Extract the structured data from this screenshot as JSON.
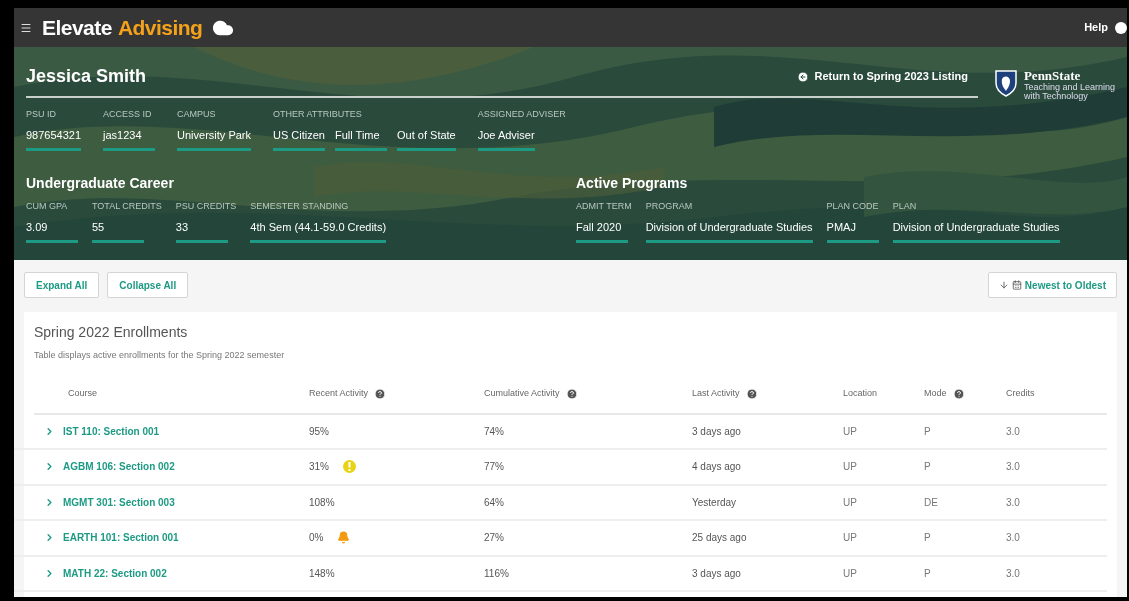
{
  "app": {
    "title_primary": "Elevate",
    "title_accent": "Advising",
    "help": "Help"
  },
  "student": {
    "name": "Jessica Smith",
    "return_link": "Return to Spring 2023 Listing",
    "logo": {
      "name": "PennState",
      "line_1": "Teaching and Learning",
      "line_2": "with Technology"
    },
    "fields": [
      {
        "label": "PSU ID",
        "values": [
          "987654321"
        ]
      },
      {
        "label": "ACCESS ID",
        "values": [
          "jas1234"
        ]
      },
      {
        "label": "CAMPUS",
        "values": [
          "University Park"
        ]
      },
      {
        "label": "OTHER ATTRIBUTES",
        "values": [
          "US Citizen",
          "Full Time",
          "Out of State"
        ]
      },
      {
        "label": "ASSIGNED ADVISER",
        "values": [
          "Joe Adviser"
        ]
      }
    ]
  },
  "career": {
    "title": "Undergraduate Career",
    "fields": [
      {
        "label": "CUM GPA",
        "value": "3.09"
      },
      {
        "label": "TOTAL CREDITS",
        "value": "55"
      },
      {
        "label": "PSU CREDITS",
        "value": "33"
      },
      {
        "label": "SEMESTER STANDING",
        "value": "4th Sem (44.1-59.0 Credits)"
      }
    ]
  },
  "programs": {
    "title": "Active Programs",
    "fields": [
      {
        "label": "ADMIT TERM",
        "value": "Fall 2020"
      },
      {
        "label": "PROGRAM",
        "value": "Division of Undergraduate Studies"
      },
      {
        "label": "PLAN CODE",
        "value": "PMAJ"
      },
      {
        "label": "PLAN",
        "value": "Division of Undergraduate Studies"
      }
    ]
  },
  "toolbar": {
    "buttons": [
      "Expand All",
      "Collapse All"
    ],
    "sort": "Newest to Oldest"
  },
  "table": {
    "title": "Spring 2022 Enrollments",
    "subtitle": "Table displays active enrollments for the Spring 2022 semester",
    "columns": [
      {
        "label": "Course",
        "help": false
      },
      {
        "label": "Recent Activity",
        "help": true
      },
      {
        "label": "Cumulative Activity",
        "help": true
      },
      {
        "label": "Last Activity",
        "help": true
      },
      {
        "label": "Location",
        "help": false
      },
      {
        "label": "Mode",
        "help": true
      },
      {
        "label": "Credits",
        "help": false
      }
    ],
    "rows": [
      {
        "course": "IST 110: Section 001",
        "recent": "95%",
        "kind": "plain",
        "cumulative": "74%",
        "last": "3 days ago",
        "location": "UP",
        "mode": "P",
        "credits": "3.0"
      },
      {
        "course": "AGBM 106: Section 002",
        "recent": "31%",
        "kind": "warning",
        "cumulative": "77%",
        "last": "4 days ago",
        "location": "UP",
        "mode": "P",
        "credits": "3.0"
      },
      {
        "course": "MGMT 301: Section 003",
        "recent": "108%",
        "kind": "plain",
        "cumulative": "64%",
        "last": "Yesterday",
        "location": "UP",
        "mode": "DE",
        "credits": "3.0"
      },
      {
        "course": "EARTH 101: Section 001",
        "recent": "0%",
        "kind": "bell",
        "cumulative": "27%",
        "last": "25 days ago",
        "location": "UP",
        "mode": "P",
        "credits": "3.0"
      },
      {
        "course": "MATH 22: Section 002",
        "recent": "148%",
        "kind": "plain",
        "cumulative": "116%",
        "last": "3 days ago",
        "location": "UP",
        "mode": "P",
        "credits": "3.0"
      }
    ]
  }
}
